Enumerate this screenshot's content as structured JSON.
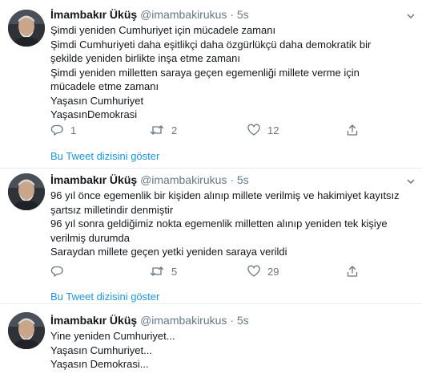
{
  "tweets": [
    {
      "author": "İmambakır Üküş",
      "handle": "@imambakirukus",
      "separator": "·",
      "time": "5s",
      "lines": [
        "Şimdi yeniden Cumhuriyet için mücadele zamanı",
        "Şimdi Cumhuriyeti daha eşitlikçi daha özgürlükçü daha demokratik bir",
        "şekilde yeniden birlikte inşa etme zamanı",
        "Şimdi yeniden milletten saraya geçen egemenliği millete verme için",
        "mücadele etme zamanı",
        "Yaşasın Cumhuriyet",
        "YaşasınDemokrasi"
      ],
      "reply_count": "1",
      "retweet_count": "2",
      "like_count": "12",
      "show_thread": "Bu Tweet dizisini göster"
    },
    {
      "author": "İmambakır Üküş",
      "handle": "@imambakirukus",
      "separator": "·",
      "time": "5s",
      "lines": [
        "96 yıl önce egemenlik bir kişiden alınıp millete verilmiş ve hakimiyet kayıtsız",
        "şartsız milletindir denmiştir",
        "96 yıl sonra geldiğimiz nokta egemenlik milletten alınıp yeniden tek kişiye",
        "verilmiş durumda",
        "Saraydan millete geçen yetki yeniden saraya verildi"
      ],
      "reply_count": "",
      "retweet_count": "5",
      "like_count": "29",
      "show_thread": "Bu Tweet dizisini göster"
    },
    {
      "author": "İmambakır Üküş",
      "handle": "@imambakirukus",
      "separator": "·",
      "time": "5s",
      "lines": [
        "Yine yeniden Cumhuriyet...",
        "Yaşasın Cumhuriyet...",
        "Yaşasın Demokrasi..."
      ]
    }
  ],
  "icons": {
    "reply": "reply-icon",
    "retweet": "retweet-icon",
    "like": "heart-icon",
    "share": "share-icon",
    "menu": "chevron-down-icon"
  },
  "colors": {
    "link": "#1b95e0",
    "secondary_text": "#657786",
    "divider": "#e6ecf0"
  }
}
